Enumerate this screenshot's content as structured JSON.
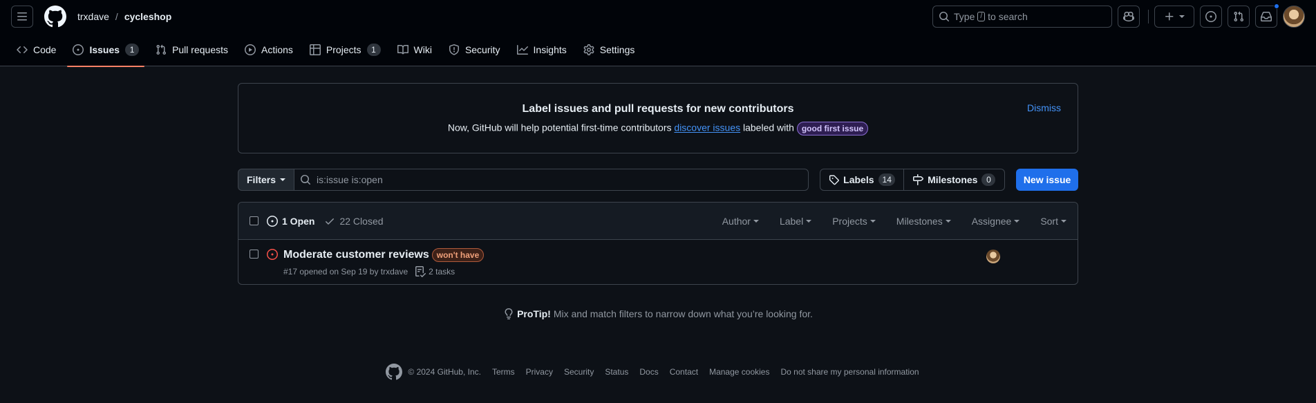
{
  "header": {
    "owner": "trxdave",
    "separator": "/",
    "repo": "cycleshop",
    "search_prefix": "Type",
    "search_key": "/",
    "search_suffix": "to search"
  },
  "nav": {
    "code": "Code",
    "issues": "Issues",
    "issues_count": "1",
    "pulls": "Pull requests",
    "actions": "Actions",
    "projects": "Projects",
    "projects_count": "1",
    "wiki": "Wiki",
    "security": "Security",
    "insights": "Insights",
    "settings": "Settings"
  },
  "banner": {
    "title": "Label issues and pull requests for new contributors",
    "text_before": "Now, GitHub will help potential first-time contributors",
    "link": "discover issues",
    "text_after": "labeled with",
    "label": "good first issue",
    "dismiss": "Dismiss"
  },
  "toolbar": {
    "filters": "Filters",
    "query": "is:issue is:open",
    "labels": "Labels",
    "labels_count": "14",
    "milestones": "Milestones",
    "milestones_count": "0",
    "new_issue": "New issue"
  },
  "list_header": {
    "open": "1 Open",
    "closed": "22 Closed",
    "author": "Author",
    "label": "Label",
    "projects": "Projects",
    "milestones": "Milestones",
    "assignee": "Assignee",
    "sort": "Sort"
  },
  "issues": [
    {
      "title": "Moderate customer reviews",
      "label": "won't have",
      "meta": "#17 opened on Sep 19 by trxdave",
      "tasks": "2 tasks"
    }
  ],
  "protip": {
    "strong": "ProTip!",
    "text": "Mix and match filters to narrow down what you’re looking for."
  },
  "footer": {
    "copyright": "© 2024 GitHub, Inc.",
    "links": [
      "Terms",
      "Privacy",
      "Security",
      "Status",
      "Docs",
      "Contact",
      "Manage cookies",
      "Do not share my personal information"
    ]
  },
  "colors": {
    "background": "#0d1117",
    "header_bg": "#010409",
    "accent_blue": "#1f6feb",
    "tab_underline": "#f78166",
    "open_issue": "#f85149"
  }
}
